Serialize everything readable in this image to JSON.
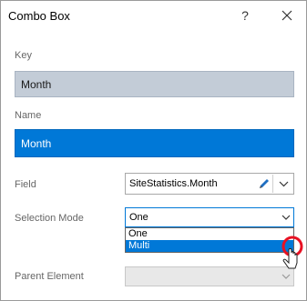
{
  "dialog": {
    "title": "Combo Box",
    "help_glyph": "?",
    "close_icon": "close-icon"
  },
  "fields": {
    "key_label": "Key",
    "key_value": "Month",
    "name_label": "Name",
    "name_value": "Month",
    "field_label": "Field",
    "field_value": "SiteStatistics.Month",
    "selection_mode_label": "Selection Mode",
    "selection_mode_value": "One",
    "selection_mode_options": [
      "One",
      "Multi"
    ],
    "selection_mode_highlighted": "Multi",
    "parent_element_label": "Parent Element",
    "parent_element_value": ""
  },
  "colors": {
    "accent": "#0078d7",
    "key_background": "#c3ccd7",
    "label_text": "#666666",
    "cursor_circle": "#e81123"
  }
}
